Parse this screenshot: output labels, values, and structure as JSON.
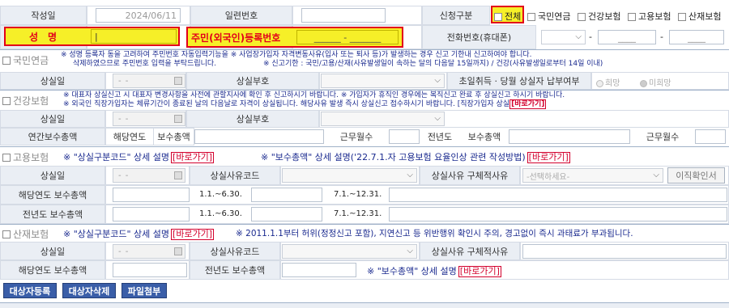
{
  "row1": {
    "date_label": "작성일",
    "date_value": "2024/06/11",
    "serial_label": "일련번호",
    "type_label": "신청구분",
    "checks": [
      "전체",
      "국민연금",
      "건강보험",
      "고용보험",
      "산재보험"
    ]
  },
  "row2": {
    "name_label": "성　명",
    "name_value": "|",
    "id_label": "주민(외국인)등록번호",
    "id_value": "______ - _______",
    "phone_label": "전화번호(휴대폰)",
    "phone_dash1": "-",
    "phone_dash2": "-",
    "phone_mid": "____",
    "phone_last": "____"
  },
  "pension": {
    "title": "국민연금",
    "notice1": "※ 성명 등록자 동을 고려하여 주민번호 자동입력기능을 ※ 사업장가입자 자격변동사유(입사 또는 퇴사 등)가 발생하는 경우 신고 기한내 신고하여야 합니다.",
    "notice2a": "삭제하였으므로 주민번호 입력을 부탁드립니다.",
    "notice2b": "※ 신고기한 : 국민/고용/산재(사유발생일이 속하는 달의 다음달 15일까지) / 건강(사유발생일로부터 14일 이내)",
    "loss_date_label": "상실일",
    "date_placeholder": "-  -",
    "loss_code_label": "상실부호",
    "initial_label": "초일취득 · 당월 상실자 납부여부",
    "opt_yes": "희망",
    "opt_no": "미희망"
  },
  "health": {
    "title": "건강보험",
    "notice1": "※ 대표자 상실신고 시 대표자 변경사항을 사전에 관할지사에 확인 후 신고하시기 바랍니다.        ※ 가입자가 휴직인 경우에는 복직신고 완료 후 상실신고 하시기 바랍니다.",
    "notice2": "※ 외국인 직장가입자는 체류기간이 종료된 날의 다음날로 자격이 상실됩니다. 해당사유 발생 즉시 상실신고 접수하시기 바랍니다. [직장가입자 상실",
    "notice2_link": "[바로가기]",
    "loss_date_label": "상실일",
    "loss_code_label": "상실부호",
    "annual_total_label": "연간보수총액",
    "year_label": "해당연도",
    "pay_label": "보수총액",
    "months_label": "근무월수",
    "prev_year_label": "전년도",
    "pay_label2": "보수총액",
    "months_label2": "근무월수"
  },
  "employment": {
    "title": "고용보험",
    "note1": "※ \"상실구분코드\" 상세 설명",
    "note2": "※ \"보수총액\" 상세 설명('22.7.1.자 고용보험 요율인상 관련 작성방법)",
    "link": "[바로가기]",
    "loss_date_label": "상실일",
    "reason_code_label": "상실사유코드",
    "reason_detail_label": "상실사유 구체적사유",
    "select_placeholder": "-선택하세요-",
    "confirm_btn": "이직확인서",
    "this_year_label": "해당연도 보수총액",
    "range1": "1.1.~6.30.",
    "range2": "7.1.~12.31.",
    "prev_year_label": "전년도 보수총액"
  },
  "accident": {
    "title": "산재보험",
    "note1": "※ \"상실구분코드\" 상세 설명",
    "link": "[바로가기]",
    "note2": "※ 2011.1.1부터 허위(정정신고 포함), 지연신고 등 위반행위 확인시 주의, 경고없이 즉시 과태료가 부과됩니다.",
    "loss_date_label": "상실일",
    "reason_code_label": "상실사유코드",
    "reason_detail_label": "상실사유 구체적사유",
    "this_year_label": "해당연도 보수총액",
    "prev_year_label": "전년도 보수총액",
    "note3": "※ \"보수총액\" 상세 설명"
  },
  "buttons": {
    "register": "대상자등록",
    "delete": "대상자삭제",
    "attach": "파일첨부"
  },
  "colors": {
    "label_bg": "#eaeef4",
    "highlight": "#f6ef28",
    "highlight_border": "#e2001a",
    "button": "#3a5ea8",
    "notice_red": "#d3002d",
    "notice_navy": "#1a2a8f"
  }
}
